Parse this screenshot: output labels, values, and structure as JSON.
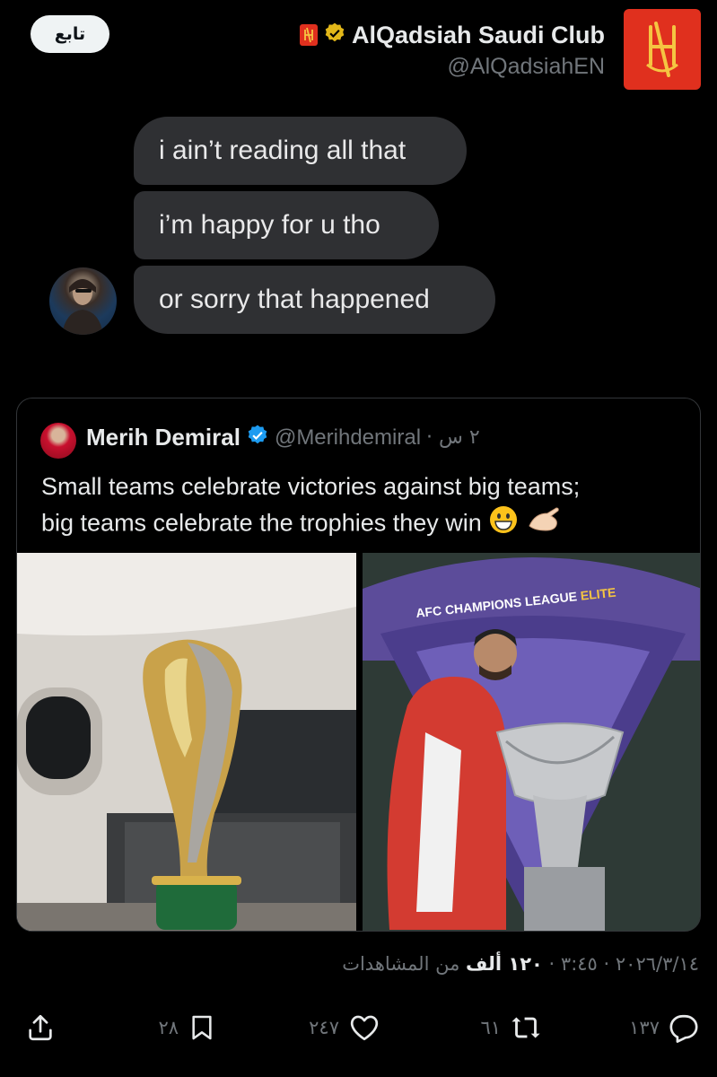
{
  "header": {
    "follow_label": "تابع",
    "display_name": "AlQadsiah Saudi Club",
    "handle": "@AlQadsiahEN",
    "brand_color": "#e0301e",
    "verified": true
  },
  "chat_screenshot": {
    "messages": [
      "i ain’t reading all that",
      "i’m happy for u tho",
      "or sorry that happened"
    ],
    "bubble_color": "#2f3033"
  },
  "quoted_tweet": {
    "name": "Merih Demiral",
    "handle": "@Merihdemiral",
    "time": "· ٢ س",
    "text_line1": "Small teams celebrate victories against big teams;",
    "text_line2": "big teams celebrate the trophies they win",
    "emojis": [
      "grinning-face-emoji",
      "pinching-hand-emoji"
    ],
    "image_right_banner": "AFC CHAMPIONS LEAGUE ELITE™"
  },
  "meta": {
    "date": "٢٠٢٦/٣/١٤",
    "time": "٣:٤٥",
    "views_value": "١٢٠ ألف",
    "views_label": "من المشاهدات"
  },
  "actions": {
    "replies": "١٣٧",
    "reposts": "٦١",
    "likes": "٢٤٧",
    "bookmarks": "٢٨"
  }
}
